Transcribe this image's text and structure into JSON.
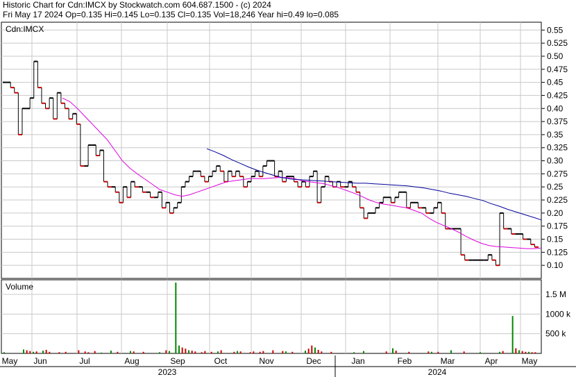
{
  "header": {
    "title": "Historic Chart for Cdn:IMCX by Stockwatch.com 604.687.1500 - (c) 2024",
    "quote": "Fri May 17 2024  Op=0.135  Hi=0.145  Lo=0.135  Cl=0.135  Vol=18,246  Year hi=0.49  lo=0.085"
  },
  "colors": {
    "up": "#000000",
    "down": "#cc0000",
    "volume_up": "#008800",
    "volume_down": "#cc0000",
    "ma_short": "#dd00dd",
    "ma_long": "#000099",
    "grid": "#c8c8c8"
  },
  "chart_data": [
    {
      "type": "line",
      "title": "Cdn:IMCX",
      "ylim": [
        0.075,
        0.565
      ],
      "y_ticks": [
        "0.55",
        "0.525",
        "0.50",
        "0.475",
        "0.45",
        "0.425",
        "0.40",
        "0.375",
        "0.35",
        "0.325",
        "0.30",
        "0.275",
        "0.25",
        "0.225",
        "0.20",
        "0.175",
        "0.15",
        "0.125",
        "0.10"
      ],
      "x_ticks": [
        "May",
        "Jun",
        "Jul",
        "Aug",
        "Sep",
        "Oct",
        "Nov",
        "Dec",
        "Jan",
        "Feb",
        "Mar",
        "Apr",
        "May"
      ],
      "years": [
        "2023",
        "2024"
      ],
      "series": [
        {
          "name": "close",
          "values": [
            0.45,
            0.45,
            0.44,
            0.43,
            0.35,
            0.4,
            0.4,
            0.42,
            0.49,
            0.44,
            0.41,
            0.4,
            0.42,
            0.38,
            0.43,
            0.41,
            0.4,
            0.38,
            0.39,
            0.37,
            0.29,
            0.29,
            0.33,
            0.33,
            0.31,
            0.32,
            0.26,
            0.25,
            0.25,
            0.24,
            0.22,
            0.25,
            0.23,
            0.26,
            0.25,
            0.25,
            0.24,
            0.24,
            0.23,
            0.23,
            0.24,
            0.21,
            0.22,
            0.2,
            0.21,
            0.22,
            0.25,
            0.26,
            0.27,
            0.28,
            0.28,
            0.27,
            0.26,
            0.27,
            0.28,
            0.29,
            0.28,
            0.26,
            0.28,
            0.27,
            0.28,
            0.27,
            0.25,
            0.26,
            0.27,
            0.28,
            0.27,
            0.29,
            0.3,
            0.3,
            0.27,
            0.28,
            0.26,
            0.27,
            0.27,
            0.26,
            0.25,
            0.26,
            0.25,
            0.27,
            0.28,
            0.22,
            0.25,
            0.27,
            0.26,
            0.25,
            0.26,
            0.25,
            0.25,
            0.26,
            0.25,
            0.24,
            0.21,
            0.19,
            0.2,
            0.2,
            0.21,
            0.22,
            0.23,
            0.23,
            0.22,
            0.23,
            0.24,
            0.24,
            0.21,
            0.22,
            0.22,
            0.21,
            0.21,
            0.2,
            0.2,
            0.21,
            0.22,
            0.2,
            0.17,
            0.17,
            0.17,
            0.17,
            0.12,
            0.11,
            0.11,
            0.11,
            0.11,
            0.11,
            0.11,
            0.12,
            0.11,
            0.1,
            0.2,
            0.17,
            0.17,
            0.16,
            0.16,
            0.16,
            0.15,
            0.15,
            0.14,
            0.135
          ]
        },
        {
          "name": "ma_short",
          "values": [
            0.42,
            0.413,
            0.4,
            0.385,
            0.37,
            0.355,
            0.34,
            0.32,
            0.3,
            0.286,
            0.275,
            0.265,
            0.255,
            0.245,
            0.24,
            0.235,
            0.232,
            0.235,
            0.24,
            0.245,
            0.25,
            0.255,
            0.26,
            0.262,
            0.264,
            0.266,
            0.266,
            0.266,
            0.267,
            0.268,
            0.268,
            0.266,
            0.262,
            0.26,
            0.258,
            0.256,
            0.252,
            0.248,
            0.243,
            0.238,
            0.232,
            0.225,
            0.22,
            0.217,
            0.215,
            0.212,
            0.21,
            0.205,
            0.2,
            0.19,
            0.182,
            0.176,
            0.17,
            0.163,
            0.155,
            0.148,
            0.142,
            0.138,
            0.136,
            0.135,
            0.134,
            0.133,
            0.132,
            0.132,
            0.133
          ]
        },
        {
          "name": "ma_long",
          "values": [
            0.323,
            0.317,
            0.31,
            0.302,
            0.295,
            0.288,
            0.282,
            0.277,
            0.272,
            0.268,
            0.265,
            0.264,
            0.263,
            0.262,
            0.261,
            0.26,
            0.259,
            0.258,
            0.257,
            0.257,
            0.256,
            0.255,
            0.254,
            0.253,
            0.252,
            0.25,
            0.248,
            0.245,
            0.242,
            0.238,
            0.235,
            0.232,
            0.228,
            0.224,
            0.218,
            0.213,
            0.207,
            0.202,
            0.197,
            0.192,
            0.187
          ]
        }
      ]
    },
    {
      "type": "bar",
      "title": "Volume",
      "ylim": [
        0,
        1800000
      ],
      "y_ticks": [
        "1.5 M",
        "1000 k",
        "500 k"
      ],
      "series": [
        {
          "name": "volume",
          "values": [
            30000,
            0,
            0,
            0,
            0,
            0,
            100000,
            80000,
            60000,
            40000,
            50000,
            0,
            70000,
            90000,
            40000,
            0,
            0,
            30000,
            0,
            40000,
            0,
            0,
            0,
            80000,
            0,
            50000,
            30000,
            0,
            60000,
            0,
            20000,
            0,
            0,
            70000,
            0,
            40000,
            0,
            0,
            0,
            60000,
            50000,
            0,
            0,
            40000,
            0,
            0,
            0,
            0,
            30000,
            0,
            80000,
            60000,
            0,
            1800000,
            200000,
            150000,
            120000,
            80000,
            70000,
            50000,
            0,
            30000,
            60000,
            0,
            40000,
            0,
            50000,
            80000,
            0,
            0,
            0,
            40000,
            60000,
            50000,
            0,
            0,
            30000,
            50000,
            0,
            40000,
            60000,
            0,
            0,
            80000,
            0,
            0,
            60000,
            50000,
            0,
            40000,
            0,
            0,
            0,
            70000,
            120000,
            200000,
            150000,
            90000,
            50000,
            0,
            0,
            40000,
            0,
            0,
            0,
            0,
            0,
            0,
            30000,
            0,
            0,
            60000,
            0,
            0,
            0,
            0,
            0,
            0,
            50000,
            0,
            130000,
            70000,
            0,
            0,
            0,
            40000,
            0,
            0,
            0,
            0,
            0,
            50000,
            40000,
            0,
            40000,
            0,
            0,
            0,
            80000,
            0,
            0,
            0,
            50000,
            0,
            0,
            0,
            0,
            30000,
            0,
            0,
            0,
            0,
            0,
            40000,
            60000,
            0,
            0,
            950000,
            130000,
            80000,
            60000,
            40000,
            40000,
            30000,
            30000
          ]
        }
      ]
    }
  ]
}
